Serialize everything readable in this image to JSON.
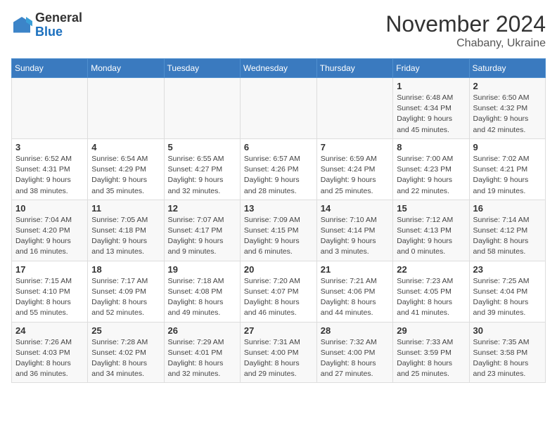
{
  "logo": {
    "general": "General",
    "blue": "Blue"
  },
  "title": "November 2024",
  "location": "Chabany, Ukraine",
  "days_of_week": [
    "Sunday",
    "Monday",
    "Tuesday",
    "Wednesday",
    "Thursday",
    "Friday",
    "Saturday"
  ],
  "weeks": [
    [
      {
        "day": "",
        "info": ""
      },
      {
        "day": "",
        "info": ""
      },
      {
        "day": "",
        "info": ""
      },
      {
        "day": "",
        "info": ""
      },
      {
        "day": "",
        "info": ""
      },
      {
        "day": "1",
        "info": "Sunrise: 6:48 AM\nSunset: 4:34 PM\nDaylight: 9 hours and 45 minutes."
      },
      {
        "day": "2",
        "info": "Sunrise: 6:50 AM\nSunset: 4:32 PM\nDaylight: 9 hours and 42 minutes."
      }
    ],
    [
      {
        "day": "3",
        "info": "Sunrise: 6:52 AM\nSunset: 4:31 PM\nDaylight: 9 hours and 38 minutes."
      },
      {
        "day": "4",
        "info": "Sunrise: 6:54 AM\nSunset: 4:29 PM\nDaylight: 9 hours and 35 minutes."
      },
      {
        "day": "5",
        "info": "Sunrise: 6:55 AM\nSunset: 4:27 PM\nDaylight: 9 hours and 32 minutes."
      },
      {
        "day": "6",
        "info": "Sunrise: 6:57 AM\nSunset: 4:26 PM\nDaylight: 9 hours and 28 minutes."
      },
      {
        "day": "7",
        "info": "Sunrise: 6:59 AM\nSunset: 4:24 PM\nDaylight: 9 hours and 25 minutes."
      },
      {
        "day": "8",
        "info": "Sunrise: 7:00 AM\nSunset: 4:23 PM\nDaylight: 9 hours and 22 minutes."
      },
      {
        "day": "9",
        "info": "Sunrise: 7:02 AM\nSunset: 4:21 PM\nDaylight: 9 hours and 19 minutes."
      }
    ],
    [
      {
        "day": "10",
        "info": "Sunrise: 7:04 AM\nSunset: 4:20 PM\nDaylight: 9 hours and 16 minutes."
      },
      {
        "day": "11",
        "info": "Sunrise: 7:05 AM\nSunset: 4:18 PM\nDaylight: 9 hours and 13 minutes."
      },
      {
        "day": "12",
        "info": "Sunrise: 7:07 AM\nSunset: 4:17 PM\nDaylight: 9 hours and 9 minutes."
      },
      {
        "day": "13",
        "info": "Sunrise: 7:09 AM\nSunset: 4:15 PM\nDaylight: 9 hours and 6 minutes."
      },
      {
        "day": "14",
        "info": "Sunrise: 7:10 AM\nSunset: 4:14 PM\nDaylight: 9 hours and 3 minutes."
      },
      {
        "day": "15",
        "info": "Sunrise: 7:12 AM\nSunset: 4:13 PM\nDaylight: 9 hours and 0 minutes."
      },
      {
        "day": "16",
        "info": "Sunrise: 7:14 AM\nSunset: 4:12 PM\nDaylight: 8 hours and 58 minutes."
      }
    ],
    [
      {
        "day": "17",
        "info": "Sunrise: 7:15 AM\nSunset: 4:10 PM\nDaylight: 8 hours and 55 minutes."
      },
      {
        "day": "18",
        "info": "Sunrise: 7:17 AM\nSunset: 4:09 PM\nDaylight: 8 hours and 52 minutes."
      },
      {
        "day": "19",
        "info": "Sunrise: 7:18 AM\nSunset: 4:08 PM\nDaylight: 8 hours and 49 minutes."
      },
      {
        "day": "20",
        "info": "Sunrise: 7:20 AM\nSunset: 4:07 PM\nDaylight: 8 hours and 46 minutes."
      },
      {
        "day": "21",
        "info": "Sunrise: 7:21 AM\nSunset: 4:06 PM\nDaylight: 8 hours and 44 minutes."
      },
      {
        "day": "22",
        "info": "Sunrise: 7:23 AM\nSunset: 4:05 PM\nDaylight: 8 hours and 41 minutes."
      },
      {
        "day": "23",
        "info": "Sunrise: 7:25 AM\nSunset: 4:04 PM\nDaylight: 8 hours and 39 minutes."
      }
    ],
    [
      {
        "day": "24",
        "info": "Sunrise: 7:26 AM\nSunset: 4:03 PM\nDaylight: 8 hours and 36 minutes."
      },
      {
        "day": "25",
        "info": "Sunrise: 7:28 AM\nSunset: 4:02 PM\nDaylight: 8 hours and 34 minutes."
      },
      {
        "day": "26",
        "info": "Sunrise: 7:29 AM\nSunset: 4:01 PM\nDaylight: 8 hours and 32 minutes."
      },
      {
        "day": "27",
        "info": "Sunrise: 7:31 AM\nSunset: 4:00 PM\nDaylight: 8 hours and 29 minutes."
      },
      {
        "day": "28",
        "info": "Sunrise: 7:32 AM\nSunset: 4:00 PM\nDaylight: 8 hours and 27 minutes."
      },
      {
        "day": "29",
        "info": "Sunrise: 7:33 AM\nSunset: 3:59 PM\nDaylight: 8 hours and 25 minutes."
      },
      {
        "day": "30",
        "info": "Sunrise: 7:35 AM\nSunset: 3:58 PM\nDaylight: 8 hours and 23 minutes."
      }
    ]
  ]
}
